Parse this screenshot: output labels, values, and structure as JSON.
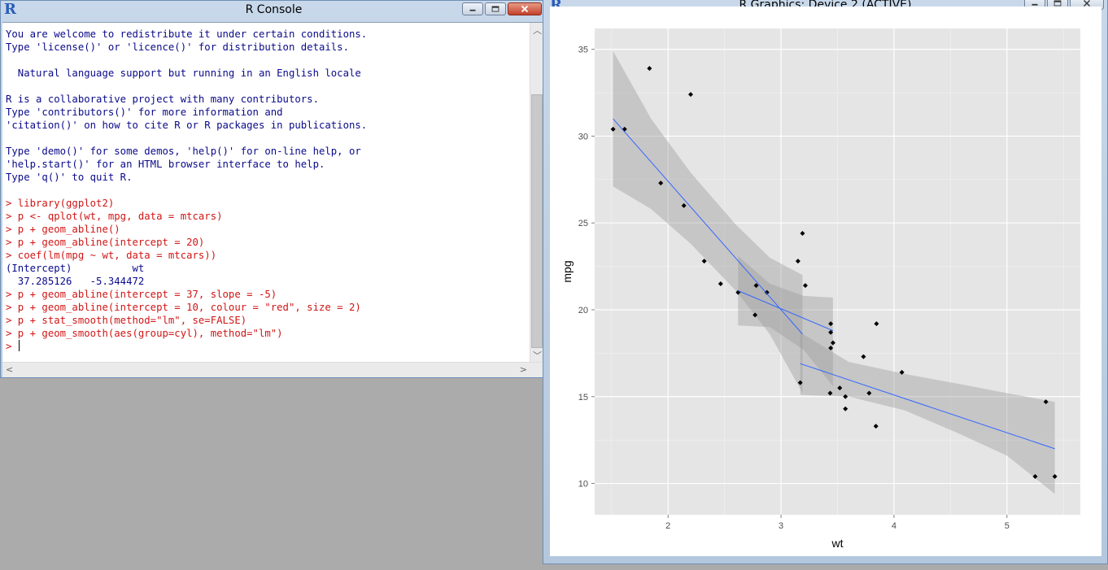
{
  "console": {
    "title": "R Console",
    "lines": [
      {
        "type": "out",
        "text": "You are welcome to redistribute it under certain conditions."
      },
      {
        "type": "out",
        "text": "Type 'license()' or 'licence()' for distribution details."
      },
      {
        "type": "out",
        "text": ""
      },
      {
        "type": "out",
        "text": "  Natural language support but running in an English locale"
      },
      {
        "type": "out",
        "text": ""
      },
      {
        "type": "out",
        "text": "R is a collaborative project with many contributors."
      },
      {
        "type": "out",
        "text": "Type 'contributors()' for more information and"
      },
      {
        "type": "out",
        "text": "'citation()' on how to cite R or R packages in publications."
      },
      {
        "type": "out",
        "text": ""
      },
      {
        "type": "out",
        "text": "Type 'demo()' for some demos, 'help()' for on-line help, or"
      },
      {
        "type": "out",
        "text": "'help.start()' for an HTML browser interface to help."
      },
      {
        "type": "out",
        "text": "Type 'q()' to quit R."
      },
      {
        "type": "out",
        "text": ""
      },
      {
        "type": "in",
        "text": "> library(ggplot2)"
      },
      {
        "type": "in",
        "text": "> p <- qplot(wt, mpg, data = mtcars)"
      },
      {
        "type": "in",
        "text": "> p + geom_abline()"
      },
      {
        "type": "in",
        "text": "> p + geom_abline(intercept = 20)"
      },
      {
        "type": "in",
        "text": "> coef(lm(mpg ~ wt, data = mtcars))"
      },
      {
        "type": "out",
        "text": "(Intercept)          wt "
      },
      {
        "type": "out",
        "text": "  37.285126   -5.344472 "
      },
      {
        "type": "in",
        "text": "> p + geom_abline(intercept = 37, slope = -5)"
      },
      {
        "type": "in",
        "text": "> p + geom_abline(intercept = 10, colour = \"red\", size = 2)"
      },
      {
        "type": "in",
        "text": "> p + stat_smooth(method=\"lm\", se=FALSE)"
      },
      {
        "type": "in",
        "text": "> p + geom_smooth(aes(group=cyl), method=\"lm\")"
      }
    ],
    "prompt": "> "
  },
  "graphics": {
    "title": "R Graphics: Device 2 (ACTIVE)"
  },
  "chart_data": {
    "type": "scatter",
    "xlabel": "wt",
    "ylabel": "mpg",
    "xlim": [
      1.35,
      5.65
    ],
    "ylim": [
      8.2,
      36.2
    ],
    "xticks": [
      2,
      3,
      4,
      5
    ],
    "yticks": [
      10,
      15,
      20,
      25,
      30,
      35
    ],
    "grid": true,
    "panel_color": "#e5e5e5",
    "point_color": "#000000",
    "line_color": "#3366ff",
    "band_color": "#999999",
    "x": [
      2.62,
      2.875,
      2.32,
      3.215,
      3.44,
      3.46,
      3.57,
      3.19,
      3.15,
      3.44,
      3.44,
      4.07,
      3.73,
      3.78,
      5.25,
      5.424,
      5.345,
      2.2,
      1.615,
      1.835,
      2.465,
      3.52,
      3.435,
      3.84,
      3.845,
      1.935,
      2.14,
      1.513,
      3.17,
      2.77,
      3.57,
      2.78
    ],
    "y": [
      21.0,
      21.0,
      22.8,
      21.4,
      18.7,
      18.1,
      14.3,
      24.4,
      22.8,
      19.2,
      17.8,
      16.4,
      17.3,
      15.2,
      10.4,
      10.4,
      14.7,
      32.4,
      30.4,
      33.9,
      21.5,
      15.5,
      15.2,
      13.3,
      19.2,
      27.3,
      26.0,
      30.4,
      15.8,
      19.7,
      15.0,
      21.4
    ],
    "series": [
      {
        "group": "4",
        "x_range": [
          1.513,
          3.19
        ],
        "y_fit": [
          31.0,
          18.6
        ],
        "se_band": {
          "x": [
            1.513,
            1.85,
            2.2,
            2.6,
            2.9,
            3.19
          ],
          "lower": [
            27.1,
            25.8,
            23.8,
            21.1,
            18.6,
            15.2
          ],
          "upper": [
            34.9,
            31.0,
            27.9,
            24.9,
            23.0,
            22.0
          ]
        }
      },
      {
        "group": "6",
        "x_range": [
          2.62,
          3.46
        ],
        "y_fit": [
          21.1,
          18.8
        ],
        "se_band": {
          "x": [
            2.62,
            2.9,
            3.2,
            3.46
          ],
          "lower": [
            19.1,
            19.0,
            17.7,
            15.6
          ],
          "upper": [
            23.1,
            21.5,
            20.8,
            20.7
          ]
        }
      },
      {
        "group": "8",
        "x_range": [
          3.17,
          5.424
        ],
        "y_fit": [
          16.9,
          12.0
        ],
        "se_band": {
          "x": [
            3.17,
            3.6,
            4.1,
            4.6,
            5.0,
            5.424
          ],
          "lower": [
            15.1,
            15.0,
            14.2,
            12.8,
            11.6,
            9.4
          ],
          "upper": [
            18.7,
            17.0,
            16.3,
            15.7,
            15.2,
            14.7
          ]
        }
      }
    ]
  }
}
